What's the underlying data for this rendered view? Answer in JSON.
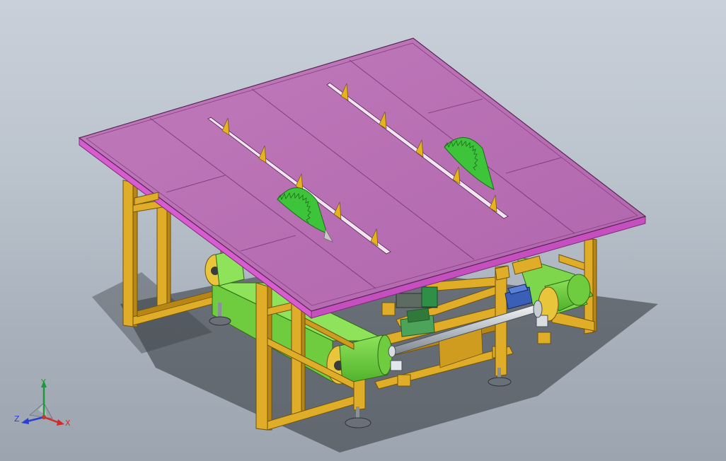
{
  "view": {
    "colors": {
      "table_top": "#b86fb4",
      "table_edge": "#8c3f86",
      "frame": "#e0ad28",
      "frame_dark": "#b98614",
      "belt": "#78d447",
      "belt_dark": "#3f9a1f",
      "blade": "#3ec43a",
      "motor_blue": "#3a5fb6",
      "shaft": "#d8dde2"
    },
    "triad": {
      "x_label": "X",
      "y_label": "Y",
      "z_label": "Z",
      "x_color": "#d42a2a",
      "y_color": "#1f9a3a",
      "z_color": "#2a3fd4"
    }
  }
}
